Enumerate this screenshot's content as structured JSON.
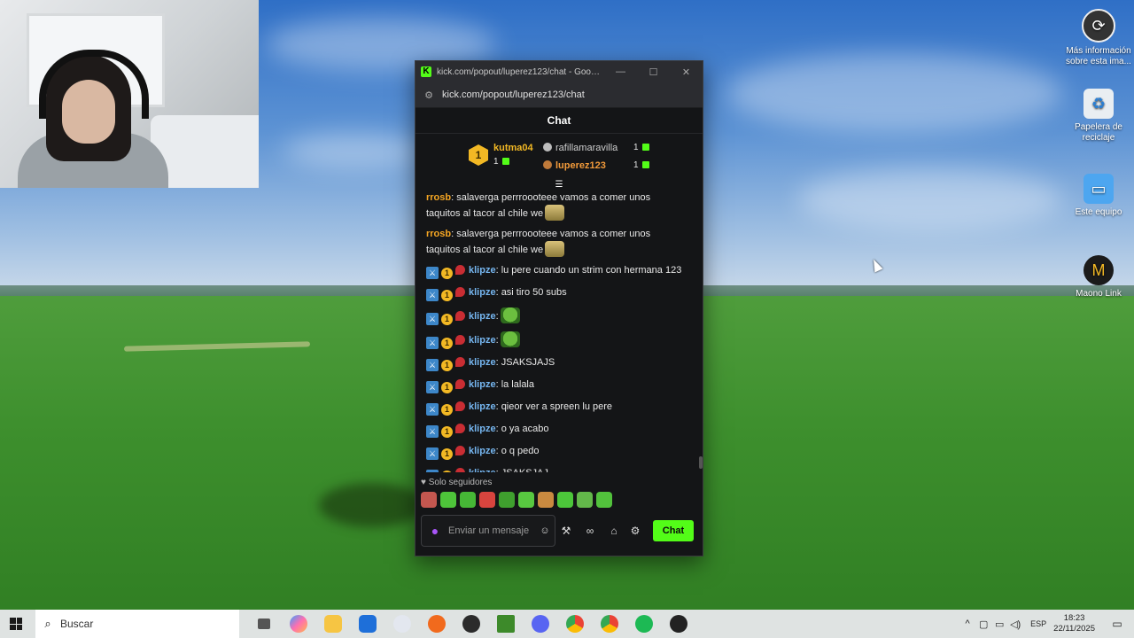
{
  "desktop": {
    "icons": [
      {
        "label": "Más información sobre esta ima...",
        "icon": "camera-info-icon"
      },
      {
        "label": "Papelera de reciclaje",
        "icon": "recycle-bin-icon"
      },
      {
        "label": "Este equipo",
        "icon": "computer-icon"
      },
      {
        "label": "Maono Link",
        "icon": "maono-link-icon"
      }
    ]
  },
  "browser": {
    "title": "kick.com/popout/luperez123/chat - Google...",
    "url": "kick.com/popout/luperez123/chat",
    "buttons": {
      "minimize": "—",
      "maximize": "☐",
      "close": "✕"
    }
  },
  "chat": {
    "header": "Chat",
    "leaderboard": {
      "first": {
        "rank": "1",
        "name": "kutma04",
        "count": "1"
      },
      "second": {
        "name": "rafillamaravilla",
        "count": "1"
      },
      "third": {
        "name": "luperez123",
        "count": "1"
      }
    },
    "messages": [
      {
        "user": "rrosb",
        "text": ": salaverga perrroooteee vamos a comer unos taquitos al tacor al chile we",
        "badges": false,
        "emote": "sign"
      },
      {
        "user": "rrosb",
        "text": ": salaverga perrroooteee vamos a comer unos taquitos al tacor al chile we",
        "badges": false,
        "emote": "sign"
      },
      {
        "user": "klipze",
        "text": ": lu pere cuando un strim con hermana 123",
        "badges": true,
        "emote": ""
      },
      {
        "user": "klipze",
        "text": ": asi tiro 50 subs",
        "badges": true,
        "emote": ""
      },
      {
        "user": "klipze",
        "text": ":",
        "badges": true,
        "emote": "pepe"
      },
      {
        "user": "klipze",
        "text": ":",
        "badges": true,
        "emote": "pepe"
      },
      {
        "user": "klipze",
        "text": ": JSAKSJAJS",
        "badges": true,
        "emote": ""
      },
      {
        "user": "klipze",
        "text": ": la lalala",
        "badges": true,
        "emote": ""
      },
      {
        "user": "klipze",
        "text": ": qieor ver a spreen lu pere",
        "badges": true,
        "emote": ""
      },
      {
        "user": "klipze",
        "text": ": o ya acabo",
        "badges": true,
        "emote": ""
      },
      {
        "user": "klipze",
        "text": ": o q pedo",
        "badges": true,
        "emote": ""
      },
      {
        "user": "klipze",
        "text": ": JSAKSJAJ",
        "badges": true,
        "emote": ""
      }
    ],
    "sub_badge": "1",
    "followers_only": "Solo seguidores",
    "input_placeholder": "Enviar un mensaje",
    "send_label": "Chat",
    "colors": {
      "kick_green": "#53fc18",
      "rrosb": "#f5a623",
      "klipze": "#76b6f0",
      "kutma04": "#f2b824",
      "rafillamaravilla": "#cfcfcf",
      "luperez123": "#f29a3a"
    }
  },
  "taskbar": {
    "search_placeholder": "Buscar",
    "language": "ESP",
    "time": "18:23",
    "date": "22/11/2025"
  }
}
